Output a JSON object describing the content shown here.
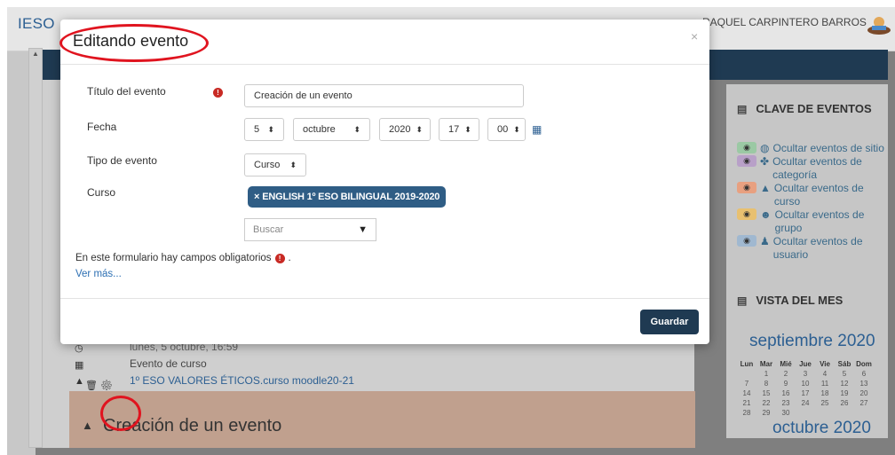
{
  "header": {
    "brand": "IESO",
    "icons": [
      "menu-icon",
      "chat-icon",
      "bell-icon"
    ],
    "user_name": "RAQUEL CARPINTERO BARROS"
  },
  "background_events": {
    "date_line": "lunes, 5 octubre, 16:59",
    "type_line": "Evento de curso",
    "course_line": "1º ESO VALORES ÉTICOS.curso moodle20-21",
    "card_title": "Creación de un evento"
  },
  "sidebar": {
    "legend_title": "CLAVE DE EVENTOS",
    "legend_items": [
      {
        "label": "Ocultar eventos de sitio",
        "color": "#9bc9a4",
        "icon": "globe-icon"
      },
      {
        "label": "Ocultar eventos de categoría",
        "color": "#b8a0c8",
        "icon": "cubes-icon"
      },
      {
        "label": "Ocultar eventos de curso",
        "color": "#e8a080",
        "icon": "graduation-cap-icon"
      },
      {
        "label": "Ocultar eventos de grupo",
        "color": "#e8c070",
        "icon": "users-icon"
      },
      {
        "label": "Ocultar eventos de usuario",
        "color": "#a0b8d0",
        "icon": "user-icon"
      }
    ],
    "month_title": "VISTA DEL MES",
    "calendar": {
      "month": "septiembre 2020",
      "weekdays": [
        "Lun",
        "Mar",
        "Mié",
        "Jue",
        "Vie",
        "Sáb",
        "Dom"
      ],
      "rows": [
        [
          "",
          "1",
          "2",
          "3",
          "4",
          "5",
          "6"
        ],
        [
          "7",
          "8",
          "9",
          "10",
          "11",
          "12",
          "13"
        ],
        [
          "14",
          "15",
          "16",
          "17",
          "18",
          "19",
          "20"
        ],
        [
          "21",
          "22",
          "23",
          "24",
          "25",
          "26",
          "27"
        ],
        [
          "28",
          "29",
          "30",
          "",
          "",
          "",
          ""
        ]
      ],
      "next_month": "octubre 2020"
    }
  },
  "modal": {
    "title": "Editando evento",
    "close": "×",
    "title_label": "Título del evento",
    "title_value": "Creación de un evento",
    "date_label": "Fecha",
    "day": "5",
    "month": "octubre",
    "year": "2020",
    "hour": "17",
    "minute": "00",
    "type_label": "Tipo de evento",
    "type_value": "Curso",
    "course_label": "Curso",
    "course_chip": "ENGLISH 1º ESO BILINGUAL 2019-2020",
    "chip_remove": "×",
    "search_placeholder": "Buscar",
    "required_note": "En este formulario hay campos obligatorios",
    "required_suffix": ".",
    "more_link": "Ver más...",
    "save_label": "Guardar"
  },
  "colors": {
    "accent": "#1f3a52",
    "chip": "#2f5d85",
    "required": "#c82a24",
    "annotation": "#e0141f",
    "event_card": "#c0a08e"
  }
}
